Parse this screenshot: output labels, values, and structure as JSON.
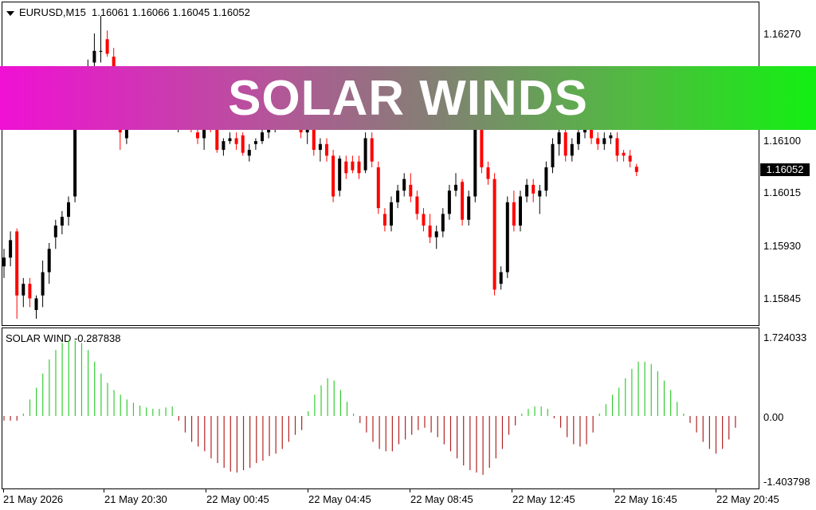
{
  "chart": {
    "symbol_label": "EURUSD,M15",
    "ohlc_label": "1.16061 1.16066 1.16045 1.16052",
    "indicator_label": "SOLAR WIND -0.287838",
    "current_price": "1.16052",
    "price_axis": [
      "1.16270",
      "1.16100",
      "1.16015",
      "1.15930",
      "1.15845"
    ],
    "indicator_axis": [
      "1.724033",
      "0.00",
      "-1.403798"
    ],
    "time_axis": [
      "21 May 2026",
      "21 May 20:30",
      "22 May 00:45",
      "22 May 04:45",
      "22 May 08:45",
      "22 May 12:45",
      "22 May 16:45",
      "22 May 20:45"
    ]
  },
  "banner": {
    "text": "SOLAR WINDS"
  },
  "colors": {
    "bull": "#000000",
    "bear": "#ff0000",
    "ind_up": "#33cc33",
    "ind_down": "#b22222"
  },
  "chart_data": {
    "type": "candlestick",
    "ylim": [
      1.158,
      1.1632
    ],
    "candles": [
      [
        1.1589,
        1.1592,
        1.1587,
        1.15905
      ],
      [
        1.15905,
        1.1595,
        1.1589,
        1.15935
      ],
      [
        1.1595,
        1.15955,
        1.158,
        1.1584
      ],
      [
        1.1584,
        1.1587,
        1.1582,
        1.1586
      ],
      [
        1.1586,
        1.1587,
        1.1582,
        1.15835
      ],
      [
        1.15815,
        1.1584,
        1.158,
        1.15835
      ],
      [
        1.1584,
        1.159,
        1.1582,
        1.1588
      ],
      [
        1.1588,
        1.1593,
        1.1586,
        1.1592
      ],
      [
        1.1594,
        1.1597,
        1.1592,
        1.1596
      ],
      [
        1.1596,
        1.15985,
        1.15945,
        1.15975
      ],
      [
        1.15975,
        1.1601,
        1.1596,
        1.16
      ],
      [
        1.1601,
        1.1619,
        1.16,
        1.1618
      ],
      [
        1.1618,
        1.1622,
        1.1616,
        1.1621
      ],
      [
        1.16215,
        1.16245,
        1.162,
        1.1623
      ],
      [
        1.1624,
        1.1629,
        1.1622,
        1.1626
      ],
      [
        1.1626,
        1.1632,
        1.1624,
        1.1626
      ],
      [
        1.1628,
        1.16295,
        1.1625,
        1.16255
      ],
      [
        1.1625,
        1.16265,
        1.162,
        1.1621
      ],
      [
        1.1621,
        1.1623,
        1.1609,
        1.1612
      ],
      [
        1.1611,
        1.1614,
        1.161,
        1.16135
      ],
      [
        1.1615,
        1.1618,
        1.1614,
        1.1617
      ],
      [
        1.1617,
        1.1621,
        1.1615,
        1.1619
      ],
      [
        1.1619,
        1.162,
        1.1615,
        1.16165
      ],
      [
        1.16165,
        1.16175,
        1.1615,
        1.16158
      ],
      [
        1.16155,
        1.1617,
        1.1614,
        1.1615
      ],
      [
        1.1615,
        1.1617,
        1.1614,
        1.1616
      ],
      [
        1.1616,
        1.1617,
        1.1613,
        1.1614
      ],
      [
        1.1614,
        1.1616,
        1.1612,
        1.1615
      ],
      [
        1.1615,
        1.1616,
        1.1613,
        1.1614
      ],
      [
        1.1614,
        1.1615,
        1.1612,
        1.1613
      ],
      [
        1.1612,
        1.1613,
        1.161,
        1.1611
      ],
      [
        1.1611,
        1.1615,
        1.1609,
        1.1614
      ],
      [
        1.1614,
        1.1616,
        1.1612,
        1.1613
      ],
      [
        1.16125,
        1.1613,
        1.16085,
        1.1609
      ],
      [
        1.1609,
        1.1611,
        1.1608,
        1.16105
      ],
      [
        1.16105,
        1.1612,
        1.161,
        1.1611
      ],
      [
        1.1611,
        1.1612,
        1.1609,
        1.161
      ],
      [
        1.16115,
        1.1612,
        1.1608,
        1.16085
      ],
      [
        1.1608,
        1.161,
        1.1607,
        1.1609
      ],
      [
        1.161,
        1.1611,
        1.1609,
        1.16105
      ],
      [
        1.16105,
        1.1613,
        1.161,
        1.1612
      ],
      [
        1.1612,
        1.1614,
        1.1611,
        1.1613
      ],
      [
        1.1613,
        1.1615,
        1.1612,
        1.1614
      ],
      [
        1.1614,
        1.1616,
        1.16125,
        1.1615
      ],
      [
        1.1615,
        1.1617,
        1.1614,
        1.1616
      ],
      [
        1.1615,
        1.1616,
        1.1613,
        1.1614
      ],
      [
        1.1614,
        1.1615,
        1.1611,
        1.1612
      ],
      [
        1.1612,
        1.1614,
        1.161,
        1.1613
      ],
      [
        1.16135,
        1.1614,
        1.1608,
        1.1609
      ],
      [
        1.1609,
        1.1611,
        1.1607,
        1.161
      ],
      [
        1.161,
        1.1611,
        1.1607,
        1.1608
      ],
      [
        1.1608,
        1.1609,
        1.16,
        1.1601
      ],
      [
        1.1602,
        1.1608,
        1.1601,
        1.16075
      ],
      [
        1.1607,
        1.1608,
        1.1604,
        1.1605
      ],
      [
        1.1607,
        1.1608,
        1.1605,
        1.16055
      ],
      [
        1.1607,
        1.1608,
        1.1604,
        1.1605
      ],
      [
        1.16055,
        1.1612,
        1.1605,
        1.1611
      ],
      [
        1.1611,
        1.1612,
        1.1606,
        1.1607
      ],
      [
        1.1606,
        1.1607,
        1.1598,
        1.1599
      ],
      [
        1.1598,
        1.1599,
        1.1595,
        1.1596
      ],
      [
        1.1596,
        1.1601,
        1.1595,
        1.16
      ],
      [
        1.16,
        1.1603,
        1.1599,
        1.1602
      ],
      [
        1.1602,
        1.1605,
        1.1601,
        1.1604
      ],
      [
        1.1603,
        1.1605,
        1.16,
        1.1601
      ],
      [
        1.1601,
        1.1602,
        1.1597,
        1.1598
      ],
      [
        1.1598,
        1.1599,
        1.1595,
        1.1596
      ],
      [
        1.1596,
        1.1598,
        1.1593,
        1.1594
      ],
      [
        1.1594,
        1.1596,
        1.1592,
        1.1595
      ],
      [
        1.1595,
        1.1599,
        1.1594,
        1.1598
      ],
      [
        1.1598,
        1.1603,
        1.1597,
        1.1602
      ],
      [
        1.1602,
        1.1605,
        1.1601,
        1.1603
      ],
      [
        1.16035,
        1.1604,
        1.1596,
        1.1597
      ],
      [
        1.1597,
        1.1602,
        1.1596,
        1.1601
      ],
      [
        1.1601,
        1.1617,
        1.16,
        1.1616
      ],
      [
        1.1616,
        1.1617,
        1.1605,
        1.1606
      ],
      [
        1.1606,
        1.1607,
        1.1603,
        1.1604
      ],
      [
        1.1604,
        1.1605,
        1.1584,
        1.1585
      ],
      [
        1.1586,
        1.1589,
        1.1585,
        1.1588
      ],
      [
        1.1588,
        1.1601,
        1.1587,
        1.16
      ],
      [
        1.16,
        1.1602,
        1.1595,
        1.1596
      ],
      [
        1.1596,
        1.1602,
        1.1595,
        1.1601
      ],
      [
        1.1601,
        1.1604,
        1.16,
        1.1603
      ],
      [
        1.1603,
        1.1604,
        1.16,
        1.16015
      ],
      [
        1.1601,
        1.1603,
        1.1598,
        1.1602
      ],
      [
        1.1602,
        1.1607,
        1.1601,
        1.1606
      ],
      [
        1.1606,
        1.1611,
        1.1605,
        1.161
      ],
      [
        1.161,
        1.1614,
        1.1608,
        1.1612
      ],
      [
        1.1612,
        1.1613,
        1.1607,
        1.1608
      ],
      [
        1.1608,
        1.1611,
        1.1607,
        1.161
      ],
      [
        1.161,
        1.1613,
        1.1609,
        1.1612
      ],
      [
        1.1612,
        1.1614,
        1.1611,
        1.1613
      ],
      [
        1.1613,
        1.1614,
        1.161,
        1.1611
      ],
      [
        1.1611,
        1.1612,
        1.1609,
        1.161
      ],
      [
        1.161,
        1.1612,
        1.1609,
        1.1611
      ],
      [
        1.1611,
        1.1612,
        1.161,
        1.16115
      ],
      [
        1.1611,
        1.1612,
        1.1607,
        1.1608
      ],
      [
        1.16085,
        1.1609,
        1.1607,
        1.1608
      ],
      [
        1.1608,
        1.1609,
        1.1606,
        1.1607
      ],
      [
        1.16061,
        1.16066,
        1.16045,
        1.16052
      ]
    ],
    "indicator": {
      "ylim": [
        -1.403798,
        1.724033
      ],
      "values": [
        -0.1,
        -0.1,
        -0.1,
        0.05,
        0.35,
        0.6,
        0.9,
        1.2,
        1.4,
        1.55,
        1.6,
        1.6,
        1.55,
        1.4,
        1.15,
        0.9,
        0.7,
        0.55,
        0.45,
        0.35,
        0.28,
        0.22,
        0.18,
        0.15,
        0.15,
        0.18,
        0.2,
        -0.1,
        -0.35,
        -0.55,
        -0.65,
        -0.75,
        -0.9,
        -1.0,
        -1.1,
        -1.18,
        -1.2,
        -1.15,
        -1.1,
        -1.0,
        -0.95,
        -0.85,
        -0.8,
        -0.7,
        -0.55,
        -0.4,
        -0.3,
        0.1,
        0.45,
        0.65,
        0.8,
        0.75,
        0.55,
        0.3,
        0.05,
        -0.15,
        -0.35,
        -0.55,
        -0.7,
        -0.75,
        -0.75,
        -0.6,
        -0.5,
        -0.4,
        -0.3,
        -0.25,
        -0.35,
        -0.45,
        -0.6,
        -0.75,
        -0.9,
        -1.05,
        -1.15,
        -1.2,
        -1.25,
        -1.1,
        -0.9,
        -0.7,
        -0.4,
        -0.2,
        0.05,
        0.15,
        0.2,
        0.2,
        0.15,
        -0.05,
        -0.25,
        -0.45,
        -0.6,
        -0.65,
        -0.6,
        -0.35,
        0.05,
        0.25,
        0.45,
        0.6,
        0.8,
        1.0,
        1.15,
        1.15,
        1.1,
        0.95,
        0.75,
        0.55,
        0.3,
        0.05,
        -0.15,
        -0.35,
        -0.55,
        -0.7,
        -0.8,
        -0.7,
        -0.5,
        -0.25
      ]
    }
  }
}
